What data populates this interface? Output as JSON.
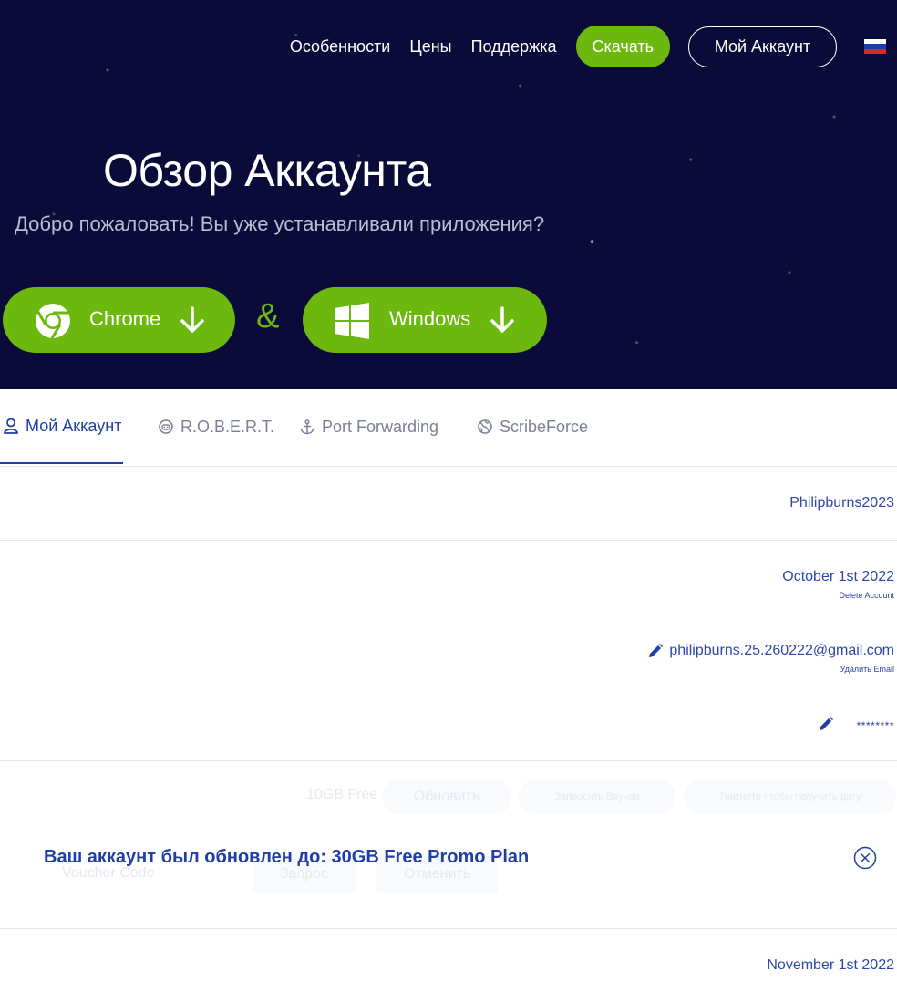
{
  "nav": {
    "features": "Особенности",
    "prices": "Цены",
    "support": "Поддержка",
    "download": "Скачать",
    "my_account": "Мой Аккаунт",
    "language_flag": "russia-flag-icon"
  },
  "hero": {
    "title": "Обзор Аккаунта",
    "subtitle": "Добро пожаловать! Вы уже устанавливали приложения?",
    "chrome_label": "Chrome",
    "windows_label": "Windows",
    "ampersand": "&"
  },
  "tabs": [
    {
      "label": "Мой Аккаунт",
      "icon": "user-icon",
      "active": true
    },
    {
      "label": "R.O.B.E.R.T.",
      "icon": "robot-icon",
      "active": false
    },
    {
      "label": "Port Forwarding",
      "icon": "anchor-icon",
      "active": false
    },
    {
      "label": "ScribeForce",
      "icon": "globe-icon",
      "active": false
    }
  ],
  "account": {
    "username": "Philipburns2023",
    "created": "October 1st 2022",
    "delete_account": "Delete Account",
    "email": "philipburns.25.260222@gmail.com",
    "delete_email": "Удалить Email",
    "password": "********"
  },
  "plan": {
    "plan_name": "10GB Free",
    "upgrade": "Обновить",
    "request_voucher": "Запросить Ваучер",
    "tweet": "Твитните чтобы получить дату",
    "voucher_placeholder": "Voucher Code",
    "request": "Запрос",
    "cancel": "Отменить"
  },
  "toast": {
    "message": "Ваш аккаунт был обновлен до: 30GB Free Promo Plan"
  },
  "expiry": {
    "date": "November 1st 2022"
  },
  "colors": {
    "hero_bg": "#0b0b3a",
    "accent_green": "#6cb80f",
    "link_blue": "#2d47a8",
    "active_blue": "#1f3fa6"
  }
}
